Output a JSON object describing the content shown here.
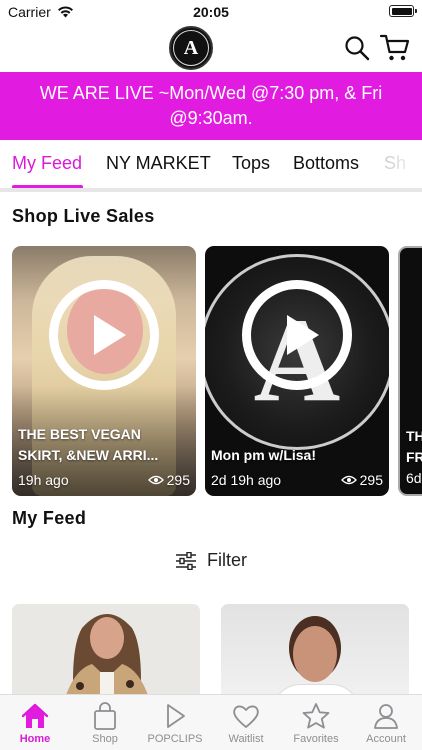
{
  "status_bar": {
    "carrier": "Carrier",
    "time": "20:05"
  },
  "banner": {
    "text": "WE ARE LIVE ~Mon/Wed @7:30 pm, & Fri @9:30am."
  },
  "tabs": [
    {
      "label": "My Feed",
      "active": true
    },
    {
      "label": "NY MARKET",
      "active": false
    },
    {
      "label": "Tops",
      "active": false
    },
    {
      "label": "Bottoms",
      "active": false
    },
    {
      "label": "Sh",
      "active": false
    }
  ],
  "live_sales": {
    "title": "Shop Live Sales",
    "cards": [
      {
        "title_line1": "THE BEST VEGAN",
        "title_line2": "SKIRT, &NEW ARRI...",
        "age": "19h ago",
        "views": "295"
      },
      {
        "title_line1": "",
        "title_line2": "Mon pm w/Lisa!",
        "age": "2d 19h ago",
        "views": "295"
      },
      {
        "title_line1": "TH",
        "title_line2": "FR",
        "age": "6d",
        "views": ""
      }
    ]
  },
  "feed": {
    "title": "My Feed",
    "filter_label": "Filter"
  },
  "bottom_nav": [
    {
      "label": "Home",
      "icon": "home-icon",
      "active": true
    },
    {
      "label": "Shop",
      "icon": "bag-icon",
      "active": false
    },
    {
      "label": "POPCLIPS",
      "icon": "play-icon",
      "active": false
    },
    {
      "label": "Waitlist",
      "icon": "heart-icon",
      "active": false
    },
    {
      "label": "Favorites",
      "icon": "star-icon",
      "active": false
    },
    {
      "label": "Account",
      "icon": "person-icon",
      "active": false
    }
  ],
  "colors": {
    "accent": "#e11be0",
    "active_text": "#d91ad9"
  }
}
